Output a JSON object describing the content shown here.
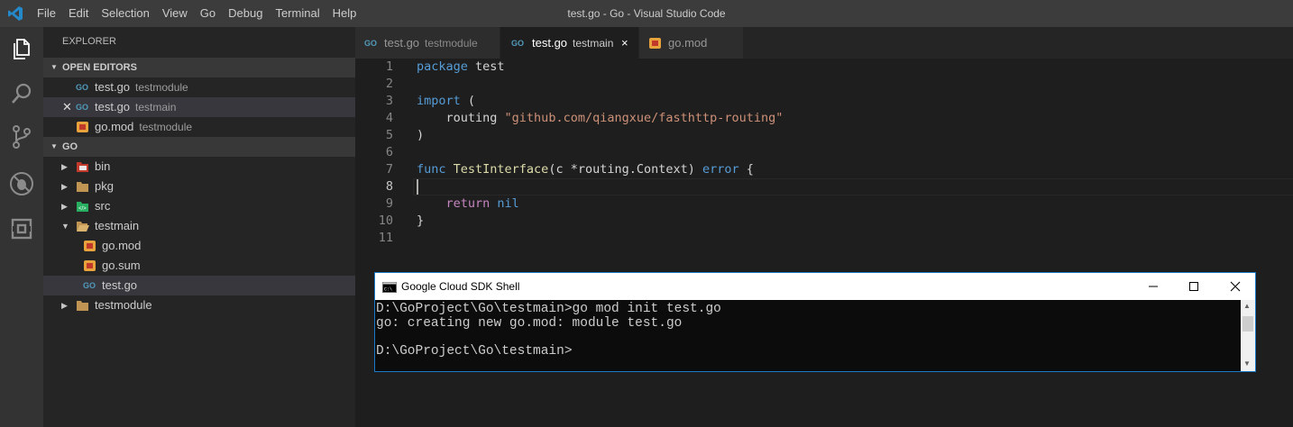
{
  "window": {
    "title": "test.go - Go - Visual Studio Code",
    "menu": [
      "File",
      "Edit",
      "Selection",
      "View",
      "Go",
      "Debug",
      "Terminal",
      "Help"
    ]
  },
  "sidebar": {
    "title": "EXPLORER",
    "open_editors_header": "OPEN EDITORS",
    "open_editors": [
      {
        "name": "test.go",
        "desc": "testmodule",
        "icon": "go-file-icon"
      },
      {
        "name": "test.go",
        "desc": "testmain",
        "icon": "go-file-icon"
      },
      {
        "name": "go.mod",
        "desc": "testmodule",
        "icon": "mod-file-icon"
      }
    ],
    "folder_header": "GO",
    "tree": [
      {
        "name": "bin",
        "icon": "bin-folder-icon"
      },
      {
        "name": "pkg",
        "icon": "folder-icon"
      },
      {
        "name": "src",
        "icon": "src-folder-icon"
      },
      {
        "name": "testmain",
        "icon": "folder-open-icon"
      },
      {
        "name": "go.mod",
        "icon": "mod-file-icon"
      },
      {
        "name": "go.sum",
        "icon": "mod-file-icon"
      },
      {
        "name": "test.go",
        "icon": "go-file-icon"
      },
      {
        "name": "testmodule",
        "icon": "folder-icon"
      }
    ]
  },
  "tabs": [
    {
      "name": "test.go",
      "desc": "testmodule"
    },
    {
      "name": "test.go",
      "desc": "testmain",
      "close": "×"
    },
    {
      "name": "go.mod",
      "desc": ""
    }
  ],
  "editor": {
    "line_numbers": [
      "1",
      "2",
      "3",
      "4",
      "5",
      "6",
      "7",
      "8",
      "9",
      "10",
      "11"
    ],
    "lines": {
      "l1_kw": "package",
      "l1_rest": " test",
      "l3_kw": "import",
      "l3_rest": " (",
      "l4_pre": "    routing ",
      "l4_str": "\"github.com/qiangxue/fasthttp-routing\"",
      "l5": ")",
      "l7_kw": "func",
      "l7_fn": " TestInterface",
      "l7_mid": "(c *routing.Context) ",
      "l7_err": "error",
      "l7_end": " {",
      "l9_pre": "    ",
      "l9_kw": "return",
      "l9_nil": " nil",
      "l10": "}"
    }
  },
  "terminal": {
    "title": "Google Cloud SDK Shell",
    "lines": [
      "D:\\GoProject\\Go\\testmain>go mod init test.go",
      "go: creating new go.mod: module test.go",
      "",
      "D:\\GoProject\\Go\\testmain>"
    ]
  },
  "colors": {
    "accent": "#1979ca",
    "go_blue": "#519aba",
    "string": "#ce9178",
    "keyword": "#569cd6"
  }
}
